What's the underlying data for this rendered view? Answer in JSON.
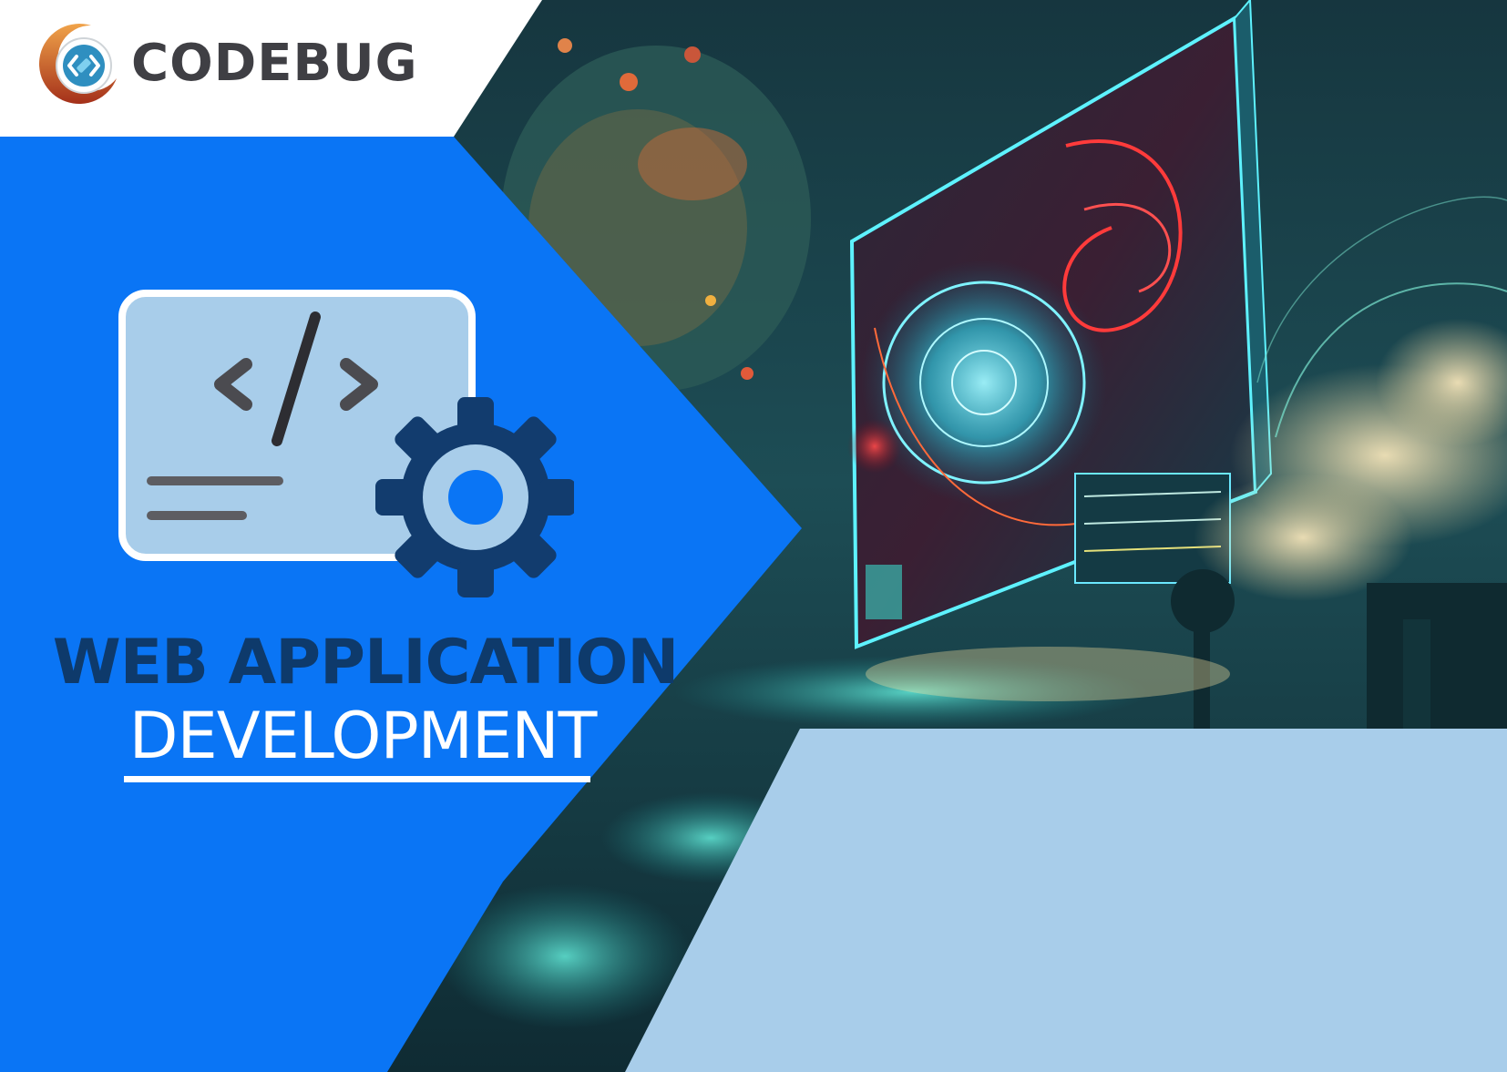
{
  "brand": {
    "name": "CODEBUG",
    "text_color": "#3f3f44",
    "ring_colors": [
      "#e38b2a",
      "#b8401d",
      "#ffffff"
    ],
    "mark_color": "#2f8fc0"
  },
  "hero": {
    "title_line1": "WEB APPLICATION",
    "title_line2": "DEVELOPMENT"
  },
  "icons": {
    "code_card": "code-window-icon",
    "gear": "gear-icon"
  },
  "colors": {
    "primary_blue": "#0a75f5",
    "light_blue_panel": "#a8cdea",
    "title_dark": "#0e3a6b",
    "header_white": "#ffffff"
  }
}
